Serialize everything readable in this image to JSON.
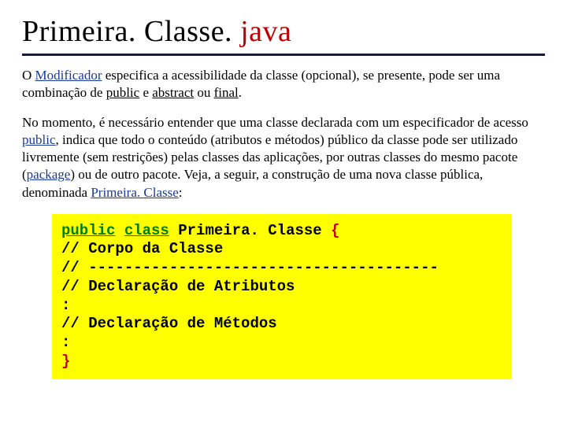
{
  "title": {
    "part1": "Primeira. Classe. ",
    "part2": "java"
  },
  "para1": {
    "t1": "O ",
    "t2": "Modificador",
    "t3": " especifica a acessibilidade da classe (opcional), se presente, pode ser uma combinação de ",
    "t4": "public",
    "t5": " e ",
    "t6": "abstract",
    "t7": " ou ",
    "t8": "final",
    "t9": "."
  },
  "para2": {
    "t1": "No momento, é necessário entender que uma classe declarada com um especificador de acesso ",
    "t2": "public",
    "t3": ", indica que todo o conteúdo (atributos e métodos) público da classe pode ser utilizado livremente (sem restrições) pelas classes das aplicações, por outras classes do mesmo pacote (",
    "t4": "package",
    "t5": ") ou de outro pacote. Veja, a seguir, a construção de uma nova classe pública, denominada ",
    "t6": "Primeira. Classe",
    "t7": ":"
  },
  "code": {
    "l1a": "public",
    "l1b": " ",
    "l1c": "class",
    "l1d": " ",
    "l1e": "Primeira. Classe",
    "l1f": " ",
    "l1g": "{",
    "l2": "// Corpo da Classe",
    "l3": "// ---------------------------------------",
    "l4": "// Declaração de Atributos",
    "l5": ":",
    "l6": "// Declaração de Métodos",
    "l7": ":",
    "l8": "}"
  }
}
